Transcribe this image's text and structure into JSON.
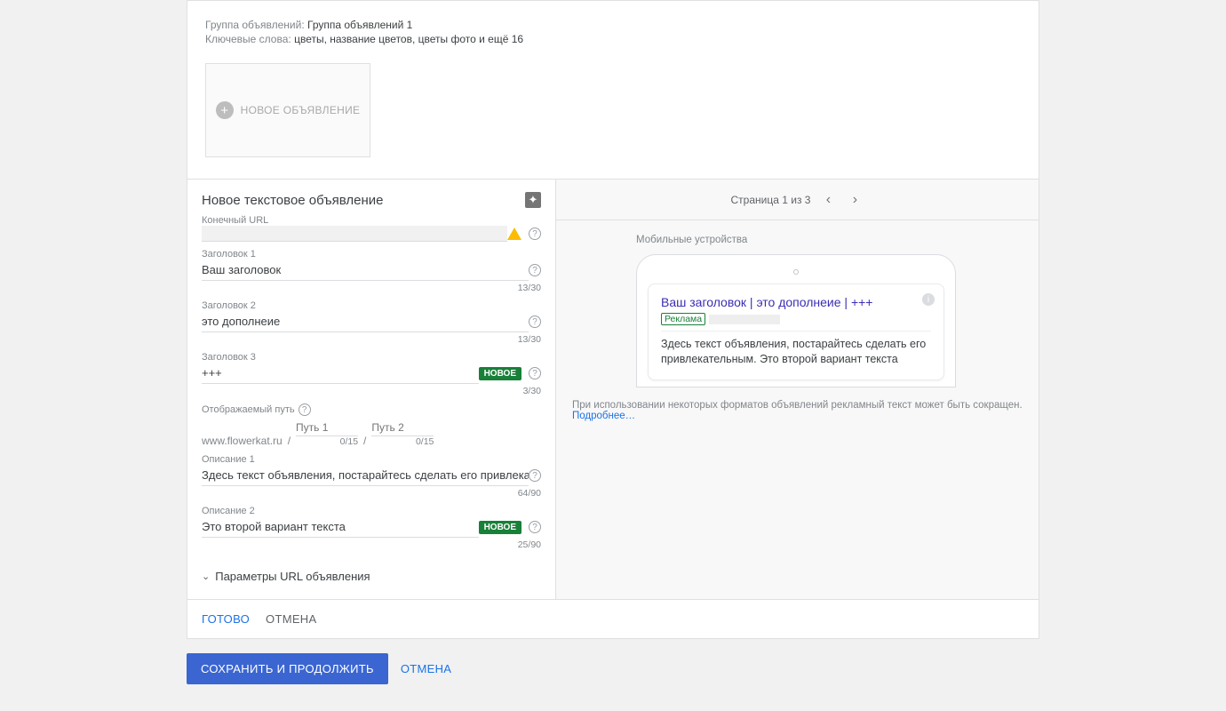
{
  "header": {
    "group_label": "Группа объявлений:",
    "group_value": "Группа объявлений 1",
    "keywords_label": "Ключевые слова:",
    "keywords_value": "цветы, название цветов, цветы фото и ещё 16",
    "new_ad_label": "НОВОЕ ОБЪЯВЛЕНИЕ"
  },
  "editor": {
    "title": "Новое текстовое объявление",
    "final_url_label": "Конечный URL",
    "headline1": {
      "label": "Заголовок 1",
      "value": "Ваш заголовок",
      "counter": "13/30"
    },
    "headline2": {
      "label": "Заголовок 2",
      "value": "это дополнеие",
      "counter": "13/30"
    },
    "headline3": {
      "label": "Заголовок 3",
      "value": "+++",
      "counter": "3/30",
      "badge": "НОВОЕ"
    },
    "path": {
      "label": "Отображаемый путь",
      "domain": "www.flowerkat.ru",
      "path1_placeholder": "Путь 1",
      "path2_placeholder": "Путь 2",
      "path1_counter": "0/15",
      "path2_counter": "0/15"
    },
    "desc1": {
      "label": "Описание 1",
      "value": "Здесь текст объявления, постарайтесь сделать его привлекательным",
      "counter": "64/90"
    },
    "desc2": {
      "label": "Описание 2",
      "value": "Это второй вариант текста",
      "counter": "25/90",
      "badge": "НОВОЕ"
    },
    "url_params_label": "Параметры URL объявления"
  },
  "preview": {
    "pager": "Страница 1 из 3",
    "device_label": "Мобильные устройства",
    "ad_title": "Ваш заголовок | это дополнеие | +++",
    "ad_badge": "Реклама",
    "ad_desc": "Здесь текст объявления, постарайтесь сделать его привлекательным. Это второй вариант текста",
    "note": "При использовании некоторых форматов объявлений рекламный текст может быть сокращен.",
    "note_link": "Подробнее…"
  },
  "actions": {
    "done": "ГОТОВО",
    "cancel_inner": "ОТМЕНА",
    "save_continue": "СОХРАНИТЬ И ПРОДОЛЖИТЬ",
    "cancel_outer": "ОТМЕНА"
  }
}
